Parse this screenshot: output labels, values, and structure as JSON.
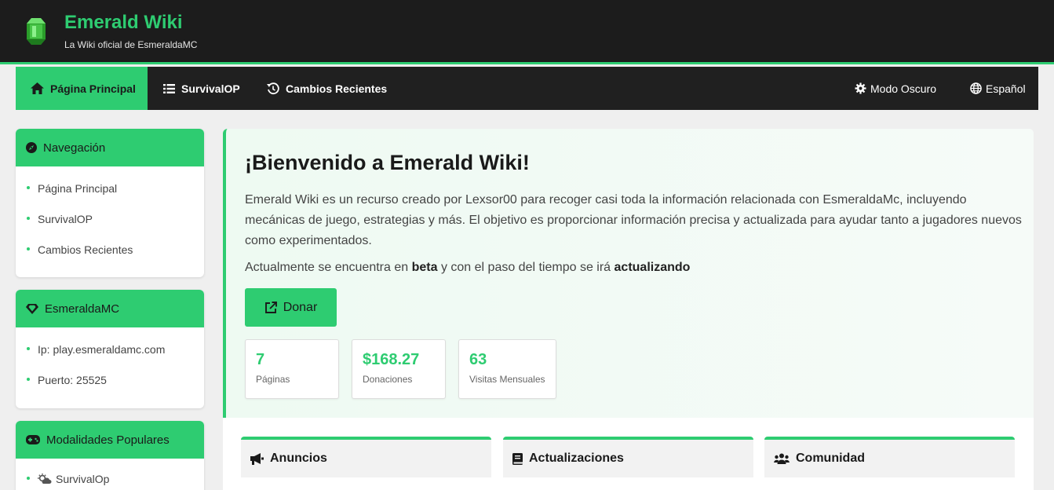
{
  "header": {
    "title": "Emerald Wiki",
    "subtitle": "La Wiki oficial de EsmeraldaMC"
  },
  "nav": {
    "items": [
      {
        "label": "Página Principal",
        "icon": "home-icon"
      },
      {
        "label": "SurvivalOP",
        "icon": "list-icon"
      },
      {
        "label": "Cambios Recientes",
        "icon": "history-icon"
      }
    ],
    "dark_mode": "Modo Oscuro",
    "language": "Español"
  },
  "sidebar": {
    "navigation": {
      "title": "Navegación",
      "items": [
        "Página Principal",
        "SurvivalOP",
        "Cambios Recientes"
      ]
    },
    "server": {
      "title": "EsmeraldaMC",
      "items": [
        "Ip: play.esmeraldamc.com",
        "Puerto: 25525"
      ]
    },
    "modes": {
      "title": "Modalidades Populares",
      "items": [
        "SurvivalOp"
      ]
    }
  },
  "hero": {
    "title": "¡Bienvenido a Emerald Wiki!",
    "description": "Emerald Wiki es un recurso creado por Lexsor00 para recoger casi toda la información relacionada con EsmeraldaMc, incluyendo mecánicas de juego, estrategias y más. El objetivo es proporcionar información precisa y actualizada para ayudar tanto a jugadores nuevos como experimentados.",
    "note_prefix": "Actualmente se encuentra en",
    "note_beta": "beta",
    "note_middle": "y con el paso del tiempo se irá",
    "note_updating": "actualizando",
    "donate": "Donar"
  },
  "stats": [
    {
      "value": "7",
      "label": "Páginas"
    },
    {
      "value": "$168.27",
      "label": "Donaciones"
    },
    {
      "value": "63",
      "label": "Visitas Mensuales"
    }
  ],
  "panels": [
    {
      "title": "Anuncios",
      "icon": "megaphone-icon"
    },
    {
      "title": "Actualizaciones",
      "icon": "book-icon"
    },
    {
      "title": "Comunidad",
      "icon": "users-icon"
    }
  ],
  "colors": {
    "accent": "#2ecc71",
    "header_bg": "#1c1c1c",
    "nav_bg": "#202020"
  }
}
